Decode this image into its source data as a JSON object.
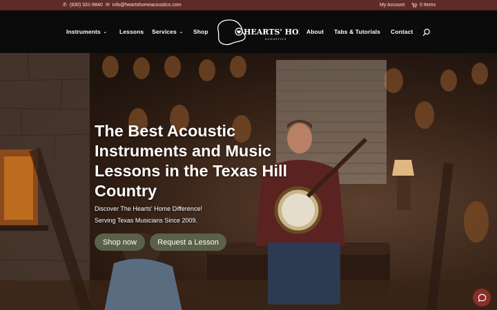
{
  "topbar": {
    "phone": "(830) 331-9840",
    "email": "info@heartshomeacoustics.com",
    "account": "My Account",
    "cart": "0 Items"
  },
  "nav": {
    "left": [
      {
        "label": "Instruments",
        "dropdown": true
      },
      {
        "label": "Lessons",
        "dropdown": false
      },
      {
        "label": "Services",
        "dropdown": true
      },
      {
        "label": "Shop",
        "dropdown": false
      }
    ],
    "right": [
      {
        "label": "About"
      },
      {
        "label": "Tabs & Tutorials"
      },
      {
        "label": "Contact"
      }
    ],
    "logo_text": "HEARTS' HOME",
    "logo_sub": "ACOUSTICS"
  },
  "hero": {
    "headline": "The Best Acoustic Instruments and Music Lessons in the Texas Hill Country",
    "sub1": "Discover The Hearts' Home Difference!",
    "sub2": "Serving Texas Musicians Since 2009.",
    "btn_shop": "Shop now",
    "btn_lesson": "Request a Lesson"
  },
  "colors": {
    "topbar": "#5f2b28",
    "nav": "#0b0b0b",
    "button": "#5a6148",
    "chat": "#8b2e26"
  }
}
